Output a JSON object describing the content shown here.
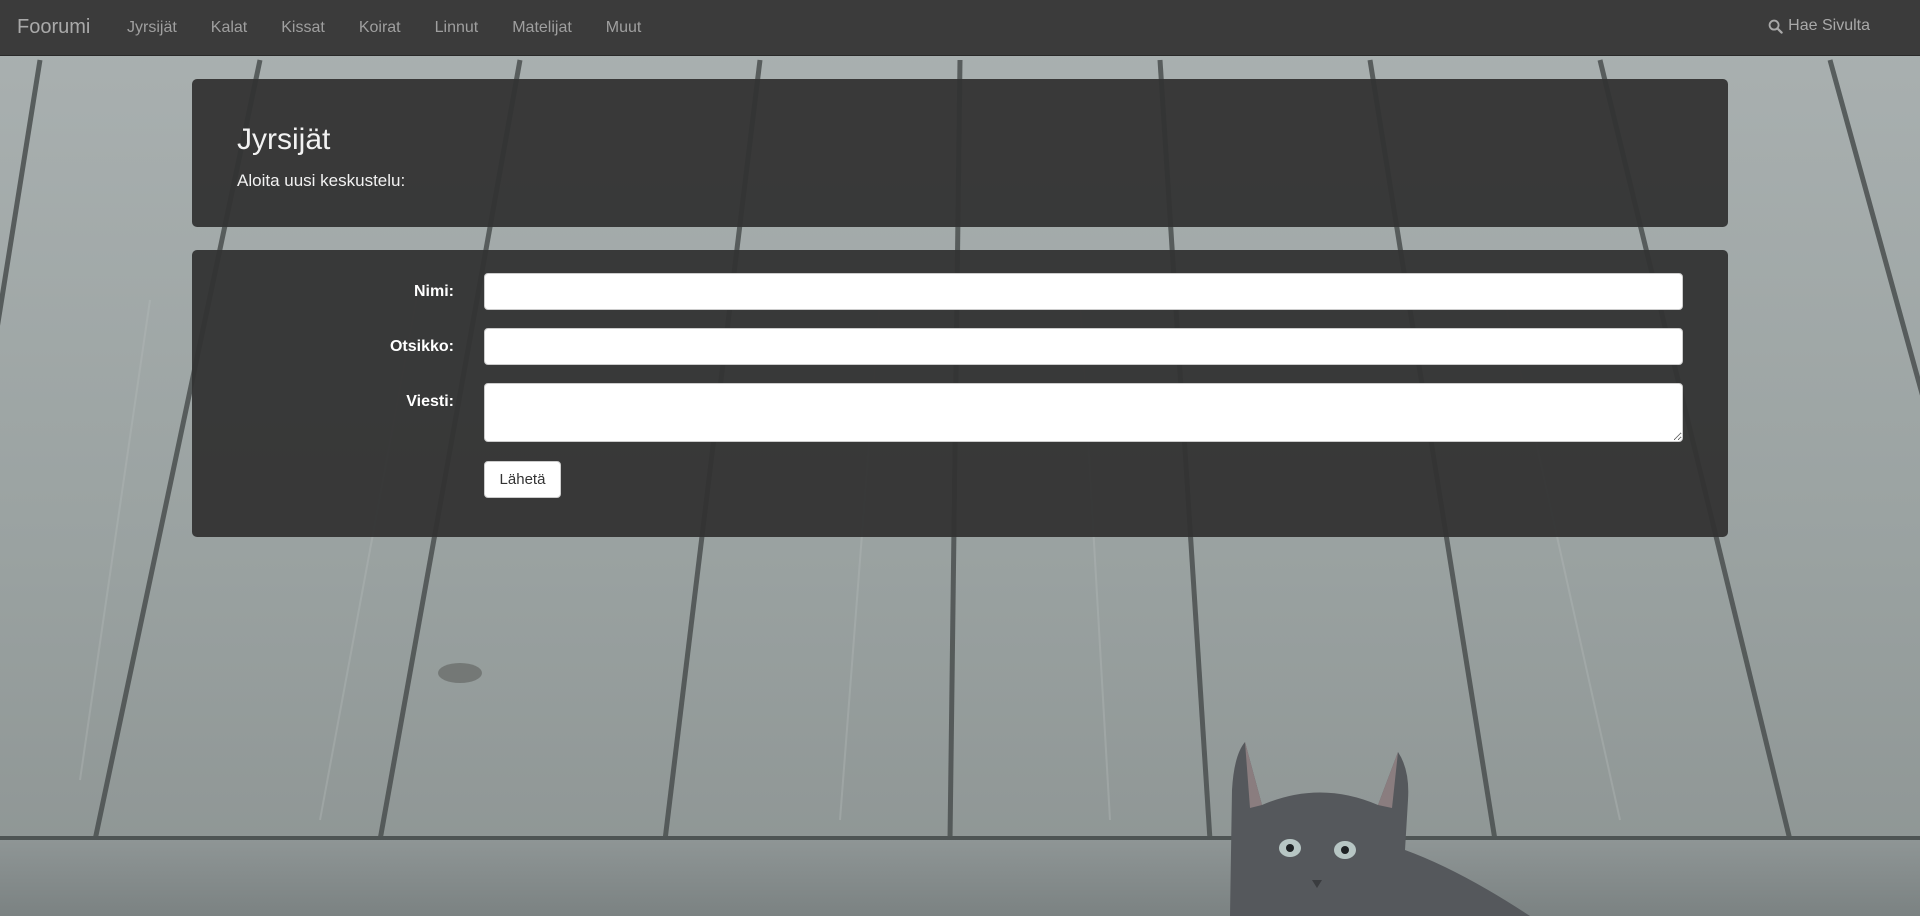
{
  "navbar": {
    "brand": "Foorumi",
    "links": [
      "Jyrsijät",
      "Kalat",
      "Kissat",
      "Koirat",
      "Linnut",
      "Matelijat",
      "Muut"
    ],
    "search_label": "Hae Sivulta",
    "search_icon": "search-icon"
  },
  "header": {
    "title": "Jyrsijät",
    "subtitle": "Aloita uusi keskustelu:"
  },
  "form": {
    "name_label": "Nimi:",
    "name_value": "",
    "subject_label": "Otsikko:",
    "subject_value": "",
    "message_label": "Viesti:",
    "message_value": "",
    "submit_label": "Lähetä"
  },
  "background": {
    "deck_color": "#9ea6a5",
    "plank_shadow": "#4a4f4f",
    "kitten_color": "#55585c"
  }
}
